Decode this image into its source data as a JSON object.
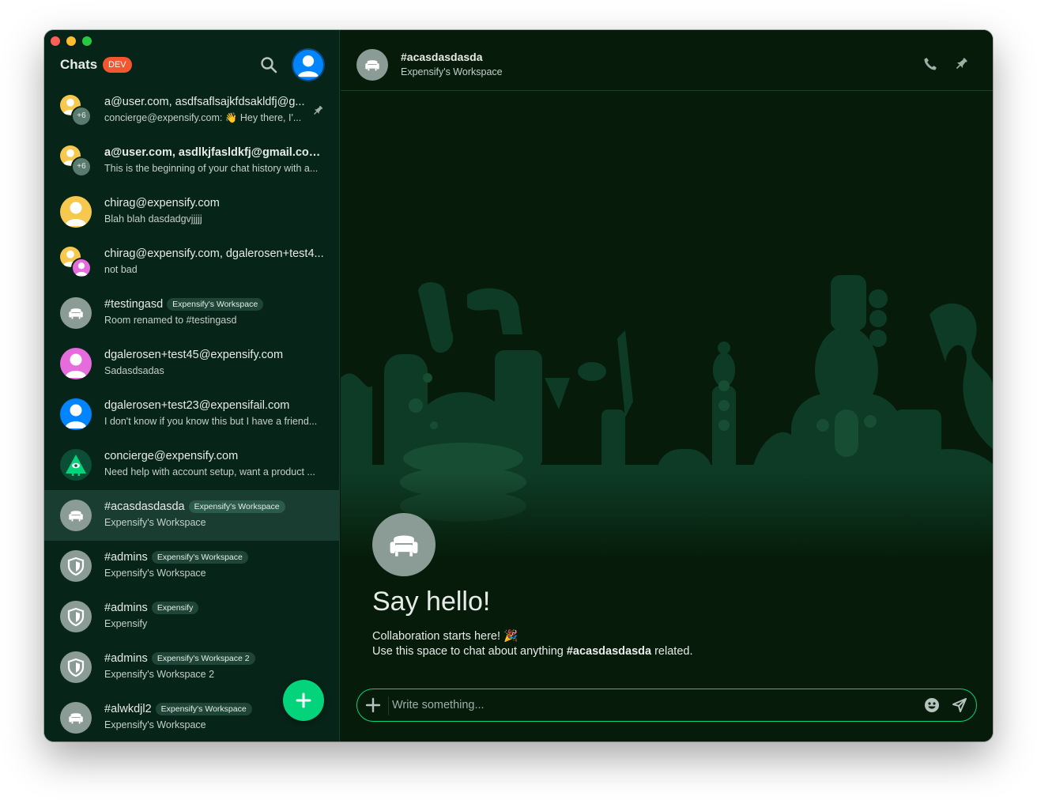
{
  "colors": {
    "accent": "#03d47c",
    "dev_badge": "#f25730",
    "sidebar_bg": "#072419",
    "main_bg": "#061b09",
    "active_row": "#1a3d32"
  },
  "sidebar": {
    "title": "Chats",
    "env_badge": "DEV",
    "search_icon": "search-icon",
    "profile_icon": "user-avatar-icon",
    "chats": [
      {
        "title": "a@user.com, asdfsaflsajkfdsakldfj@g...",
        "subtitle": "concierge@expensify.com: 👋 Hey there, I'...",
        "avatar": "group",
        "count": "+6",
        "pinned": true,
        "bold": false
      },
      {
        "title": "a@user.com, asdlkjfasldkfj@gmail.com,...",
        "subtitle": "This is the beginning of your chat history with a...",
        "avatar": "group",
        "count": "+6",
        "pinned": false,
        "bold": true
      },
      {
        "title": "chirag@expensify.com",
        "subtitle": "Blah blah dasdadgvjjjjj",
        "avatar": "user-yellow",
        "pinned": false,
        "bold": false
      },
      {
        "title": "chirag@expensify.com, dgalerosen+test4...",
        "subtitle": "not bad",
        "avatar": "pair",
        "pinned": false,
        "bold": false
      },
      {
        "title": "#testingasd",
        "badge": "Expensify's Workspace",
        "subtitle": "Room renamed to #testingasd",
        "avatar": "room",
        "pinned": false,
        "bold": false
      },
      {
        "title": "dgalerosen+test45@expensify.com",
        "subtitle": "Sadasdsadas",
        "avatar": "user-pink",
        "pinned": false,
        "bold": false
      },
      {
        "title": "dgalerosen+test23@expensifail.com",
        "subtitle": "I don't know if you know this but I have a friend...",
        "avatar": "user-blue",
        "pinned": false,
        "bold": false
      },
      {
        "title": "concierge@expensify.com",
        "subtitle": "Need help with account setup, want a product ...",
        "avatar": "concierge",
        "pinned": false,
        "bold": false
      },
      {
        "title": "#acasdasdasda",
        "badge": "Expensify's Workspace",
        "subtitle": "Expensify's Workspace",
        "avatar": "room",
        "pinned": false,
        "bold": false,
        "active": true
      },
      {
        "title": "#admins",
        "badge": "Expensify's Workspace",
        "subtitle": "Expensify's Workspace",
        "avatar": "shield",
        "pinned": false,
        "bold": false
      },
      {
        "title": "#admins",
        "badge": "Expensify",
        "subtitle": "Expensify",
        "avatar": "shield",
        "pinned": false,
        "bold": false
      },
      {
        "title": "#admins",
        "badge": "Expensify's Workspace 2",
        "subtitle": "Expensify's Workspace 2",
        "avatar": "shield",
        "pinned": false,
        "bold": false
      },
      {
        "title": "#alwkdjl2",
        "badge": "Expensify's Workspace",
        "subtitle": "Expensify's Workspace",
        "avatar": "room",
        "pinned": false,
        "bold": false
      }
    ],
    "fab_icon": "plus-icon"
  },
  "header": {
    "room_name": "#acasdasdasda",
    "workspace": "Expensify's Workspace",
    "call_icon": "phone-icon",
    "pin_icon": "pin-icon"
  },
  "welcome": {
    "title": "Say hello!",
    "line1": "Collaboration starts here! 🎉",
    "line2_prefix": "Use this space to chat about anything ",
    "line2_room": "#acasdasdasda",
    "line2_suffix": " related."
  },
  "composer": {
    "placeholder": "Write something...",
    "value": "",
    "add_icon": "plus-icon",
    "emoji_icon": "emoji-icon",
    "send_icon": "send-icon"
  }
}
